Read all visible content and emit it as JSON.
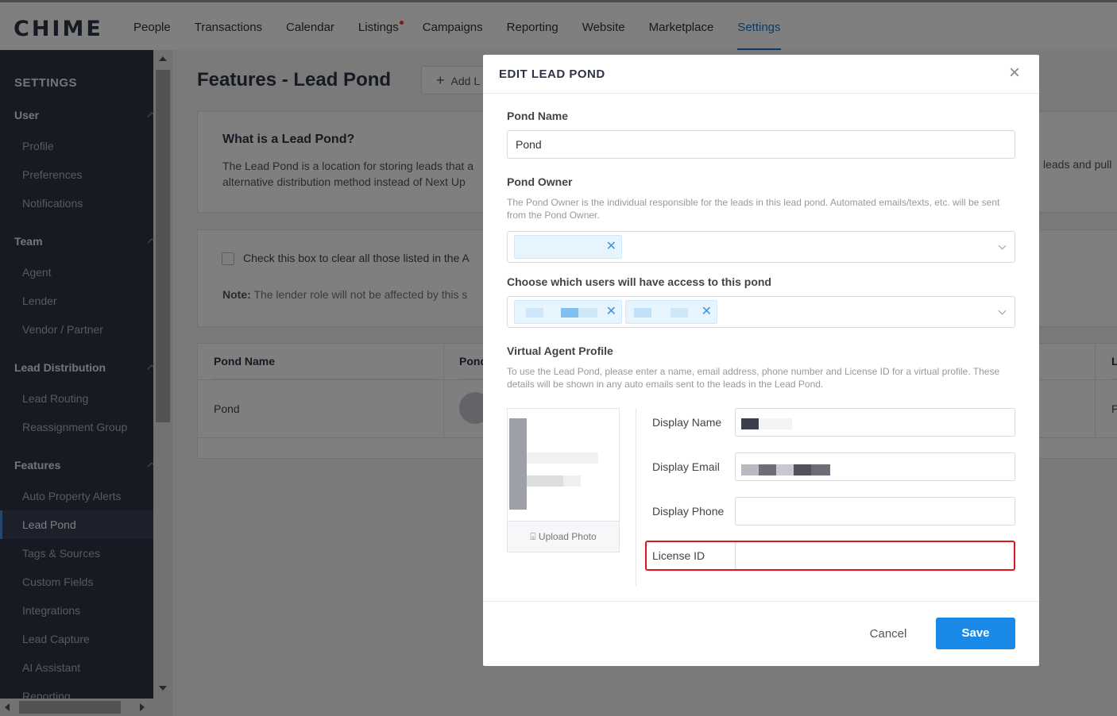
{
  "app": {
    "logo": "CHIME"
  },
  "nav": {
    "items": [
      {
        "label": "People"
      },
      {
        "label": "Transactions"
      },
      {
        "label": "Calendar"
      },
      {
        "label": "Listings"
      },
      {
        "label": "Campaigns"
      },
      {
        "label": "Reporting"
      },
      {
        "label": "Website"
      },
      {
        "label": "Marketplace"
      },
      {
        "label": "Settings"
      }
    ],
    "active": "Settings"
  },
  "sidebar": {
    "title": "SETTINGS",
    "groups": {
      "user": "User",
      "team": "Team",
      "lead_distribution": "Lead Distribution",
      "features": "Features"
    },
    "items": {
      "profile": "Profile",
      "preferences": "Preferences",
      "notifications": "Notifications",
      "agent": "Agent",
      "lender": "Lender",
      "vendor": "Vendor / Partner",
      "lead_routing": "Lead Routing",
      "reassignment": "Reassignment Group",
      "auto_property": "Auto Property Alerts",
      "lead_pond": "Lead Pond",
      "tags_sources": "Tags & Sources",
      "custom_fields": "Custom Fields",
      "integrations": "Integrations",
      "lead_capture": "Lead Capture",
      "ai_assistant": "AI Assistant",
      "reporting": "Reporting"
    }
  },
  "main": {
    "title": "Features - Lead Pond",
    "add_button": "Add L",
    "info": {
      "heading": "What is a Lead Pond?",
      "text_line1": "The Lead Pond is a location for storing leads that a",
      "text_line2": "alternative distribution method instead of Next Up",
      "text_right": "leads and pull"
    },
    "clear_box_label": "Check this box to clear all those listed in the A",
    "note_label": "Note:",
    "note_text": "The lender role will not be affected by this s",
    "table": {
      "headers": [
        "Pond Name",
        "Pond",
        "L"
      ],
      "row": {
        "name": "Pond",
        "last_col": "P"
      }
    }
  },
  "modal": {
    "title": "EDIT LEAD POND",
    "close": "×",
    "pond_name": {
      "label": "Pond Name",
      "value": "Pond"
    },
    "pond_owner": {
      "label": "Pond Owner",
      "description": "The Pond Owner is the individual responsible for the leads in this lead pond. Automated emails/texts, etc. will be sent from the Pond Owner."
    },
    "access": {
      "label": "Choose which users will have access to this pond"
    },
    "virtual_profile": {
      "label": "Virtual Agent Profile",
      "description": "To use the Lead Pond, please enter a name, email address, phone number and License ID for a virtual profile. These details will be shown in any auto emails sent to the leads in the Lead Pond.",
      "upload_photo": "Upload Photo",
      "display_name_label": "Display Name",
      "display_email_label": "Display Email",
      "display_phone_label": "Display Phone",
      "license_id_label": "License ID",
      "license_id_value": ""
    },
    "cancel": "Cancel",
    "save": "Save"
  },
  "colors": {
    "accent": "#1a8ae8",
    "sidebar_bg": "#2d3447",
    "highlight": "#e0141f"
  }
}
